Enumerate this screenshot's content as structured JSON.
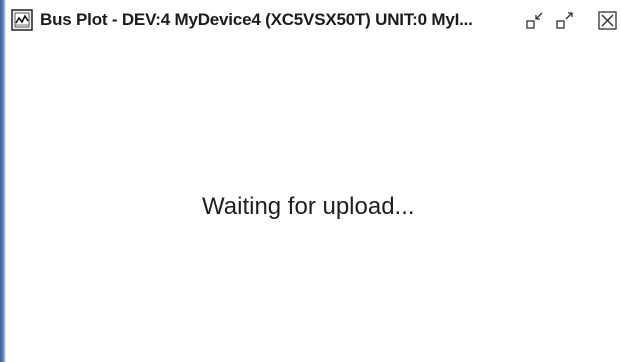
{
  "window": {
    "title": "Bus Plot - DEV:4 MyDevice4 (XC5VSX50T) UNIT:0 MyI...",
    "icon": "bus-plot-window-icon",
    "controls": {
      "minimize_icon": "minimize-icon",
      "maximize_icon": "maximize-icon",
      "close_icon": "close-icon"
    }
  },
  "content": {
    "status_message": "Waiting for upload..."
  },
  "colors": {
    "window_border": "#4a6fa8",
    "background": "#ffffff",
    "text": "#1e1e1e"
  }
}
